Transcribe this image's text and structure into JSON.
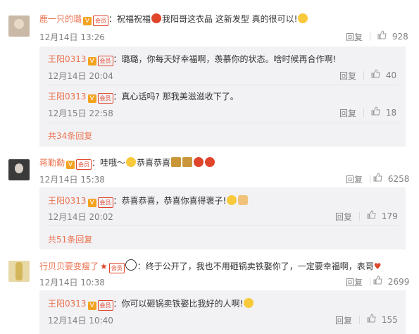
{
  "comments": [
    {
      "author": "鹿一只的璐",
      "verified_mark": "V",
      "badge": "会员",
      "text": "：祝福祝福",
      "text_tail": "我阳哥这衣品 这新发型 真的很可以!",
      "time": "12月14日 13:26",
      "reply_label": "回复",
      "likes": "928",
      "replies": [
        {
          "author": "王阳0313",
          "verified_mark": "V",
          "badge": "会员",
          "text": "：璐璐，你每天好幸福啊，羡慕你的状态。啥时候再合作啊!",
          "time": "12月14日 20:04",
          "reply_label": "回复",
          "likes": "40"
        },
        {
          "author": "王阳0313",
          "verified_mark": "V",
          "badge": "会员",
          "text": "：真心话吗? 那我美滋滋收下了。",
          "time": "12月15日 22:58",
          "reply_label": "回复",
          "likes": "18"
        }
      ],
      "more_link": "共34条回复"
    },
    {
      "author": "蒋勤勤",
      "verified_mark": "V",
      "badge": "会员",
      "text": "：哇哦～",
      "text_tail": "恭喜恭喜",
      "time": "12月14日 15:38",
      "reply_label": "回复",
      "likes": "6258",
      "replies": [
        {
          "author": "王阳0313",
          "verified_mark": "V",
          "badge": "会员",
          "text": "：恭喜恭喜，恭喜你喜得褒子!",
          "time": "12月14日 20:02",
          "reply_label": "回复",
          "likes": "179"
        }
      ],
      "more_link": "共51条回复"
    },
    {
      "author": "行贝贝要变瘦了",
      "badge": "会员",
      "text": "：终于公开了，我也不用砸锅卖铁娶你了，一定要幸福啊，表哥",
      "time": "12月14日 10:38",
      "reply_label": "回复",
      "likes": "2699",
      "replies": [
        {
          "author": "王阳0313",
          "verified_mark": "V",
          "badge": "会员",
          "text": "：你可以砸锅卖铁娶比我好的人啊!",
          "time": "12月14日 10:40",
          "reply_label": "回复",
          "likes": "155"
        }
      ]
    }
  ],
  "colors": {
    "name": "#eb7350",
    "time": "#808080",
    "subbox": "#f2f2f5",
    "vip": "#f3a21f"
  }
}
